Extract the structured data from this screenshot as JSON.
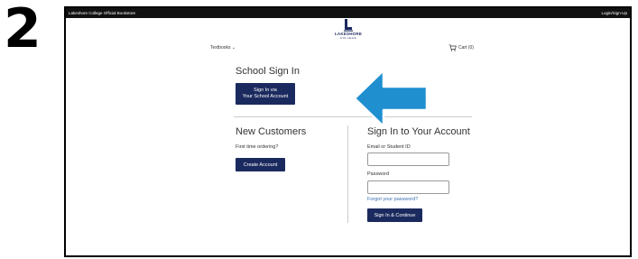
{
  "step": {
    "number": "2"
  },
  "topbar": {
    "store_name": "Lakeshore College Official Bookstore",
    "login_link": "Login/Sign-Up"
  },
  "logo": {
    "name": "LAKESHORE",
    "sub": "COLLEGE"
  },
  "nav": {
    "textbooks": "Textbooks",
    "cart": "Cart (0)"
  },
  "school_signin": {
    "title": "School Sign In",
    "button_line1": "Sign In via",
    "button_line2": "Your School Account"
  },
  "new_customers": {
    "title": "New Customers",
    "prompt": "First time ordering?",
    "button": "Create Account"
  },
  "account_signin": {
    "title": "Sign In to Your Account",
    "email_label": "Email or Student ID",
    "password_label": "Password",
    "forgot_link": "Forgot your password?",
    "button": "Sign In & Continue"
  },
  "colors": {
    "brand_navy": "#1b2a5e",
    "arrow_blue": "#1f8fd0",
    "link_blue": "#3a6fb0"
  },
  "icons": {
    "cart": "cart-icon",
    "chevron": "chevron-down-icon",
    "arrow": "arrow-left-icon"
  }
}
